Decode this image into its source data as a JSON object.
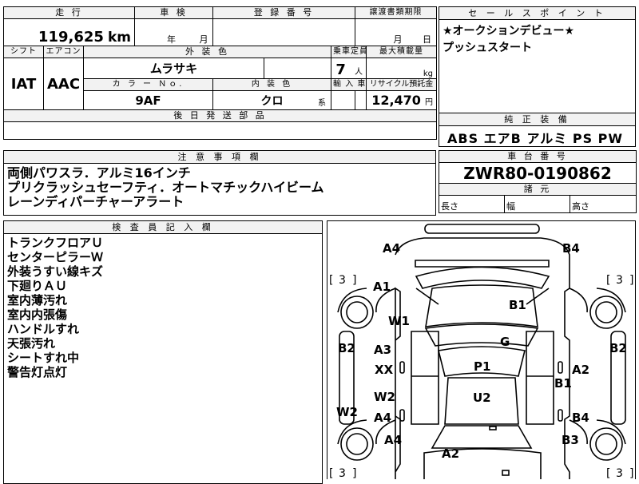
{
  "top_left": {
    "headers": {
      "mileage": "走 行",
      "inspection": "車 検",
      "registration": "登 録 番 号",
      "transfer": "譲渡書類期限"
    },
    "mileage_value": "119,625",
    "mileage_unit": "km",
    "inspection_year_unit": "年",
    "inspection_month_unit": "月",
    "transfer_month_unit": "月",
    "transfer_day_unit": "日"
  },
  "row2": {
    "headers": {
      "shift": "シフト",
      "aircon": "エアコン",
      "exterior_color": "外 装 色",
      "capacity": "乗車定員",
      "max_load": "最大積載量"
    },
    "shift": "IAT",
    "aircon": "AAC",
    "exterior_color": "ムラサキ",
    "capacity": "7",
    "capacity_unit": "人",
    "load_unit": "kg"
  },
  "row3": {
    "headers": {
      "color_no": "カ ラ ー Ｎｏ.",
      "interior_color": "内 装 色",
      "import": "輸 入 車",
      "recycle": "リサイクル預託金"
    },
    "color_no": "9AF",
    "interior_color": "クロ",
    "interior_suffix": "系",
    "recycle_fee": "12,470",
    "recycle_unit": "円"
  },
  "later_parts": {
    "header": "後 日 発 送 部 品"
  },
  "sales_point": {
    "header": "セ ー ル ス ポ イ ン ト",
    "lines": [
      "★オークションデビュー★",
      "プッシュスタート"
    ]
  },
  "genuine_equipment": {
    "header": "純 正 装 備",
    "value": "ABS エアB アルミ PS PW"
  },
  "notes": {
    "header": "注 意 事 項 欄",
    "lines": [
      "両側パワスラ．アルミ16インチ",
      "プリクラッシュセーフティ．オートマチックハイビーム",
      "レーンディパーチャーアラート"
    ]
  },
  "chassis": {
    "header": "車 台 番 号",
    "value": "ZWR80-0190862",
    "spec_header": "諸 元",
    "length": "長さ",
    "width": "幅",
    "height": "高さ"
  },
  "inspector": {
    "header": "検 査 員 記 入 欄",
    "lines": [
      "トランクフロアＵ",
      "センターピラーＷ",
      "外装うすい線キズ",
      "下廻りＡＵ",
      "室内薄汚れ",
      "室内内張傷",
      "ハンドルすれ",
      "天張汚れ",
      "シートすれ中",
      "警告灯点灯"
    ]
  },
  "diagram_marks": {
    "a4_tl": "A4",
    "b4_tr": "B4",
    "a1": "A1",
    "b1_top": "B1",
    "w1": "W1",
    "g": "G",
    "b2_l": "B2",
    "b2_r": "B2",
    "a3": "A3",
    "xx": "XX",
    "p1": "P1",
    "a2_r": "A2",
    "b1_r": "B1",
    "w2_l": "W2",
    "w2": "W2",
    "a4_mid": "A4",
    "u2": "U2",
    "b4_r": "B4",
    "a4_bl": "A4",
    "b3": "B3",
    "a2_bot": "A2",
    "tire_tl": "3",
    "tire_tr": "3",
    "tire_bl": "3",
    "tire_br": "3"
  }
}
